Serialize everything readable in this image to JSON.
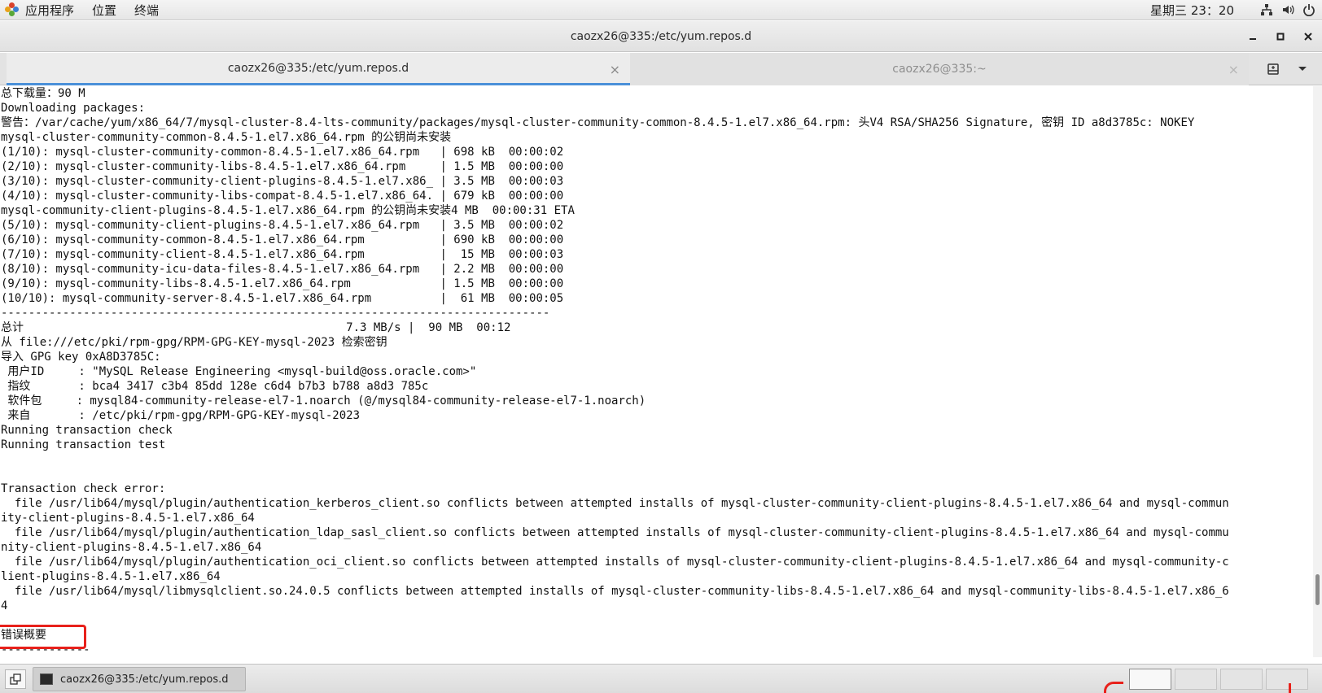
{
  "top_panel": {
    "menu": [
      "应用程序",
      "位置",
      "终端"
    ],
    "clock": "星期三 23：20",
    "icons": [
      "network-icon",
      "volume-icon",
      "power-icon"
    ]
  },
  "window": {
    "title": "caozx26@335:/etc/yum.repos.d"
  },
  "tabs": [
    {
      "label": "caozx26@335:/etc/yum.repos.d",
      "active": true
    },
    {
      "label": "caozx26@335:~",
      "active": false
    }
  ],
  "terminal": {
    "lines": [
      "总下载量：90 M",
      "Downloading packages:",
      "警告：/var/cache/yum/x86_64/7/mysql-cluster-8.4-lts-community/packages/mysql-cluster-community-common-8.4.5-1.el7.x86_64.rpm: 头V4 RSA/SHA256 Signature, 密钥 ID a8d3785c: NOKEY",
      "mysql-cluster-community-common-8.4.5-1.el7.x86_64.rpm 的公钥尚未安装",
      "(1/10): mysql-cluster-community-common-8.4.5-1.el7.x86_64.rpm   | 698 kB  00:00:02",
      "(2/10): mysql-cluster-community-libs-8.4.5-1.el7.x86_64.rpm     | 1.5 MB  00:00:00",
      "(3/10): mysql-cluster-community-client-plugins-8.4.5-1.el7.x86_ | 3.5 MB  00:00:03",
      "(4/10): mysql-cluster-community-libs-compat-8.4.5-1.el7.x86_64. | 679 kB  00:00:00",
      "mysql-community-client-plugins-8.4.5-1.el7.x86_64.rpm 的公钥尚未安装4 MB  00:00:31 ETA",
      "(5/10): mysql-community-client-plugins-8.4.5-1.el7.x86_64.rpm   | 3.5 MB  00:00:02",
      "(6/10): mysql-community-common-8.4.5-1.el7.x86_64.rpm           | 690 kB  00:00:00",
      "(7/10): mysql-community-client-8.4.5-1.el7.x86_64.rpm           |  15 MB  00:00:03",
      "(8/10): mysql-community-icu-data-files-8.4.5-1.el7.x86_64.rpm   | 2.2 MB  00:00:00",
      "(9/10): mysql-community-libs-8.4.5-1.el7.x86_64.rpm             | 1.5 MB  00:00:00",
      "(10/10): mysql-community-server-8.4.5-1.el7.x86_64.rpm          |  61 MB  00:00:05",
      "--------------------------------------------------------------------------------",
      "总计                                               7.3 MB/s |  90 MB  00:12",
      "从 file:///etc/pki/rpm-gpg/RPM-GPG-KEY-mysql-2023 检索密钥",
      "导入 GPG key 0xA8D3785C:",
      " 用户ID     : \"MySQL Release Engineering <mysql-build@oss.oracle.com>\"",
      " 指纹       : bca4 3417 c3b4 85dd 128e c6d4 b7b3 b788 a8d3 785c",
      " 软件包     : mysql84-community-release-el7-1.noarch (@/mysql84-community-release-el7-1.noarch)",
      " 来自       : /etc/pki/rpm-gpg/RPM-GPG-KEY-mysql-2023",
      "Running transaction check",
      "Running transaction test",
      "",
      "",
      "Transaction check error:",
      "  file /usr/lib64/mysql/plugin/authentication_kerberos_client.so conflicts between attempted installs of mysql-cluster-community-client-plugins-8.4.5-1.el7.x86_64 and mysql-commun",
      "ity-client-plugins-8.4.5-1.el7.x86_64",
      "  file /usr/lib64/mysql/plugin/authentication_ldap_sasl_client.so conflicts between attempted installs of mysql-cluster-community-client-plugins-8.4.5-1.el7.x86_64 and mysql-commu",
      "nity-client-plugins-8.4.5-1.el7.x86_64",
      "  file /usr/lib64/mysql/plugin/authentication_oci_client.so conflicts between attempted installs of mysql-cluster-community-client-plugins-8.4.5-1.el7.x86_64 and mysql-community-c",
      "lient-plugins-8.4.5-1.el7.x86_64",
      "  file /usr/lib64/mysql/libmysqlclient.so.24.0.5 conflicts between attempted installs of mysql-cluster-community-libs-8.4.5-1.el7.x86_64 and mysql-community-libs-8.4.5-1.el7.x86_6",
      "4",
      "",
      "错误概要",
      "-------------"
    ]
  },
  "taskbar": {
    "task_label": "caozx26@335:/etc/yum.repos.d"
  }
}
